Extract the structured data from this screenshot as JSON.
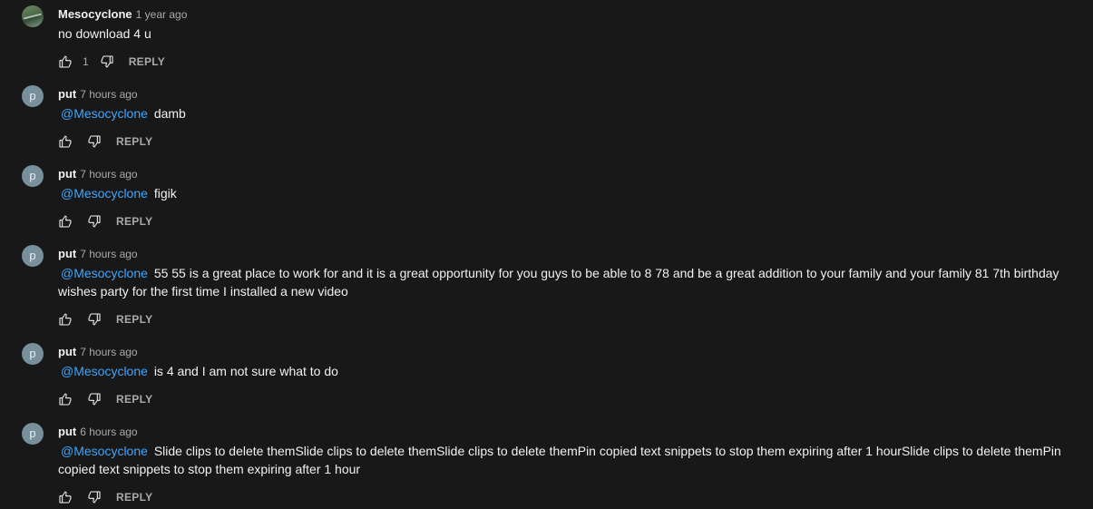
{
  "comments": [
    {
      "author": "Mesocyclone",
      "time": "1 year ago",
      "avatar": "photo",
      "mention": "",
      "text": "no download 4 u",
      "likes": "1",
      "reply_label": "REPLY"
    },
    {
      "author": "put",
      "time": "7 hours ago",
      "avatar": "p",
      "mention": "@Mesocyclone",
      "text": "damb",
      "likes": "",
      "reply_label": "REPLY"
    },
    {
      "author": "put",
      "time": "7 hours ago",
      "avatar": "p",
      "mention": "@Mesocyclone",
      "text": "figik",
      "likes": "",
      "reply_label": "REPLY"
    },
    {
      "author": "put",
      "time": "7 hours ago",
      "avatar": "p",
      "mention": "@Mesocyclone",
      "text": "55 55 is a great place to work for and it is a great opportunity for you guys to be able to 8 78 and be a great addition to your family and your family 81 7th birthday wishes party for the first time I installed a new video",
      "likes": "",
      "reply_label": "REPLY"
    },
    {
      "author": "put",
      "time": "7 hours ago",
      "avatar": "p",
      "mention": "@Mesocyclone",
      "text": "is 4 and I am not sure what to do",
      "likes": "",
      "reply_label": "REPLY"
    },
    {
      "author": "put",
      "time": "6 hours ago",
      "avatar": "p",
      "mention": "@Mesocyclone",
      "text": "Slide clips to delete themSlide clips to delete themSlide clips to delete themPin copied text snippets to stop them expiring after 1 hourSlide clips to delete themPin copied text snippets to stop them expiring after 1 hour",
      "likes": "",
      "reply_label": "REPLY"
    }
  ],
  "icons": {
    "like": "thumbs-up-icon",
    "dislike": "thumbs-down-icon"
  },
  "colors": {
    "background": "#181818",
    "text": "#f1f1f1",
    "secondary": "#aaaaaa",
    "mention": "#3ea6ff",
    "avatar_letter_bg": "#78909c"
  }
}
